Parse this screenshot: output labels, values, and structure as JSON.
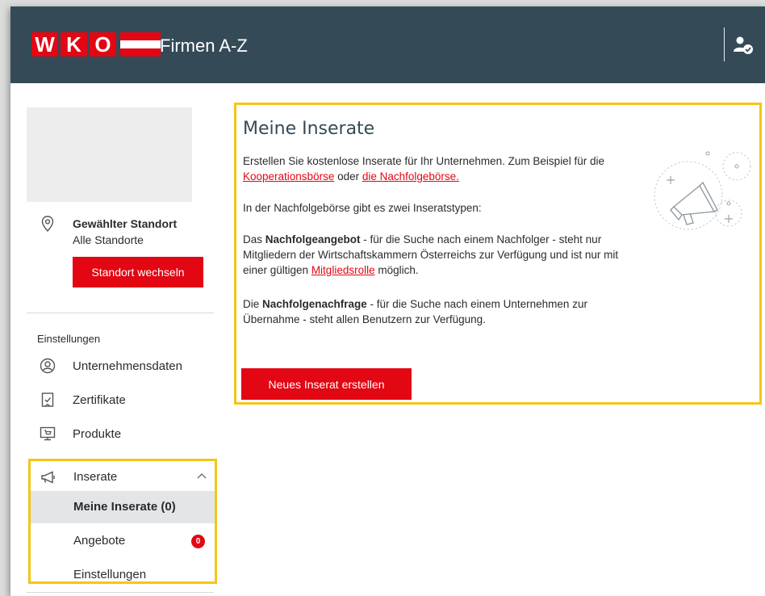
{
  "header": {
    "logo_letters": [
      "W",
      "K",
      "O"
    ],
    "app_title": "Firmen A-Z",
    "user_icon": "user-check-icon"
  },
  "sidebar": {
    "location": {
      "title": "Gewählter Standort",
      "value": "Alle Standorte",
      "button_label": "Standort wechseln",
      "icon": "map-pin-icon"
    },
    "settings_heading": "Einstellungen",
    "items": [
      {
        "label": "Unternehmensdaten",
        "icon": "user-circle-icon"
      },
      {
        "label": "Zertifikate",
        "icon": "certificate-icon"
      },
      {
        "label": "Produkte",
        "icon": "product-cart-icon"
      }
    ],
    "inserate": {
      "label": "Inserate",
      "icon": "megaphone-icon",
      "expanded": true,
      "subitems": [
        {
          "label": "Meine Inserate (0)",
          "active": true
        },
        {
          "label": "Angebote",
          "badge": "0"
        },
        {
          "label": "Einstellungen"
        }
      ]
    }
  },
  "main": {
    "title": "Meine Inserate",
    "para1_text": "Erstellen Sie kostenlose Inserate für Ihr Unternehmen. Zum Beispiel für die ",
    "para1_link1": "Kooperationsbörse",
    "para1_mid": " oder ",
    "para1_link2": "die Nachfolgebörse.",
    "para2": "In der Nachfolgebörse gibt es zwei Inseratstypen:",
    "para3_pre": "Das ",
    "para3_bold": "Nachfolgeangebot",
    "para3_text": " - für die Suche nach einem Nachfolger - steht nur Mitgliedern der Wirtschaftskammern Österreichs zur Verfügung und ist nur mit einer gültigen ",
    "para3_link": "Mitgliedsrolle",
    "para3_post": " möglich.",
    "para4_pre": "Die ",
    "para4_bold": "Nachfolgenachfrage",
    "para4_text": " - für die Suche nach einem Unternehmen zur Übernahme - steht allen Benutzern zur Verfügung.",
    "button_label": "Neues Inserat erstellen",
    "illustration_icon": "megaphone-illustration-icon"
  },
  "colors": {
    "header_bg": "#344b57",
    "brand_red": "#e30613",
    "highlight": "#f5c518"
  }
}
